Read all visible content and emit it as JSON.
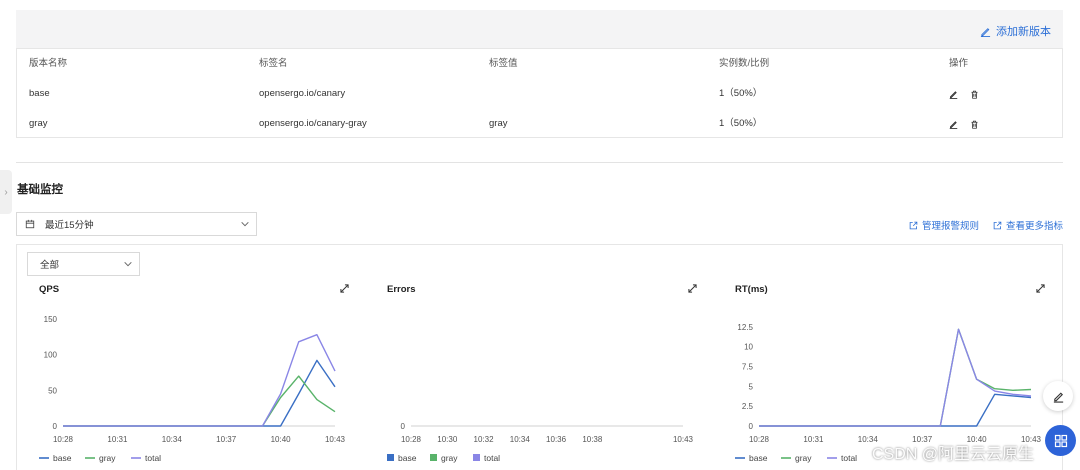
{
  "versions": {
    "add_label": "添加新版本",
    "columns": [
      "版本名称",
      "标签名",
      "标签值",
      "实例数/比例",
      "操作"
    ],
    "rows": [
      {
        "name": "base",
        "label_name": "opensergo.io/canary",
        "label_value": "",
        "instances": "1（50%）"
      },
      {
        "name": "gray",
        "label_name": "opensergo.io/canary-gray",
        "label_value": "gray",
        "instances": "1（50%）"
      }
    ]
  },
  "monitor": {
    "title": "基础监控",
    "time_range": "最近15分钟",
    "manage_alerts": "管理报警规则",
    "more_metrics": "查看更多指标",
    "scope": "全部"
  },
  "colors": {
    "base": "#3a6fc4",
    "gray": "#59b36a",
    "total": "#8a86e6",
    "link": "#2c6fd6"
  },
  "watermark": "CSDN @阿里云云原生",
  "chart_data": [
    {
      "type": "line",
      "title": "QPS",
      "x_ticks": [
        "10:28",
        "10:31",
        "10:34",
        "10:37",
        "10:40",
        "10:43"
      ],
      "x": [
        "10:28",
        "10:29",
        "10:30",
        "10:31",
        "10:32",
        "10:33",
        "10:34",
        "10:35",
        "10:36",
        "10:37",
        "10:38",
        "10:39",
        "10:40",
        "10:41",
        "10:42",
        "10:43"
      ],
      "ylim": [
        0,
        150
      ],
      "y_ticks": [
        0,
        50,
        100,
        150
      ],
      "legend_style": "line",
      "series": [
        {
          "name": "base",
          "values": [
            0,
            0,
            0,
            0,
            0,
            0,
            0,
            0,
            0,
            0,
            0,
            0,
            0,
            45,
            92,
            55
          ]
        },
        {
          "name": "gray",
          "values": [
            0,
            0,
            0,
            0,
            0,
            0,
            0,
            0,
            0,
            0,
            0,
            0,
            40,
            70,
            37,
            20
          ]
        },
        {
          "name": "total",
          "values": [
            0,
            0,
            0,
            0,
            0,
            0,
            0,
            0,
            0,
            0,
            0,
            0,
            45,
            118,
            128,
            77
          ]
        }
      ]
    },
    {
      "type": "bar",
      "title": "Errors",
      "x_ticks": [
        "10:28",
        "10:30",
        "10:32",
        "10:34",
        "10:36",
        "10:38",
        "10:43"
      ],
      "ylim": [
        0,
        1
      ],
      "y_ticks": [
        0
      ],
      "legend_style": "square",
      "series": [
        {
          "name": "base",
          "values": []
        },
        {
          "name": "gray",
          "values": []
        },
        {
          "name": "total",
          "values": []
        }
      ]
    },
    {
      "type": "line",
      "title": "RT(ms)",
      "x_ticks": [
        "10:28",
        "10:31",
        "10:34",
        "10:37",
        "10:40",
        "10:43"
      ],
      "x": [
        "10:28",
        "10:29",
        "10:30",
        "10:31",
        "10:32",
        "10:33",
        "10:34",
        "10:35",
        "10:36",
        "10:37",
        "10:38",
        "10:39",
        "10:40",
        "10:41",
        "10:42",
        "10:43"
      ],
      "ylim": [
        0,
        13.5
      ],
      "y_ticks": [
        0,
        2.5,
        5,
        7.5,
        10,
        12.5
      ],
      "legend_style": "line",
      "series": [
        {
          "name": "base",
          "values": [
            0,
            0,
            0,
            0,
            0,
            0,
            0,
            0,
            0,
            0,
            0,
            0,
            0,
            4.0,
            3.8,
            3.6
          ]
        },
        {
          "name": "gray",
          "values": [
            0,
            0,
            0,
            0,
            0,
            0,
            0,
            0,
            0,
            0,
            0,
            12.2,
            5.9,
            4.7,
            4.5,
            4.6
          ]
        },
        {
          "name": "total",
          "values": [
            0,
            0,
            0,
            0,
            0,
            0,
            0,
            0,
            0,
            0,
            0,
            12.2,
            5.9,
            4.4,
            4.0,
            3.8
          ]
        }
      ]
    }
  ]
}
